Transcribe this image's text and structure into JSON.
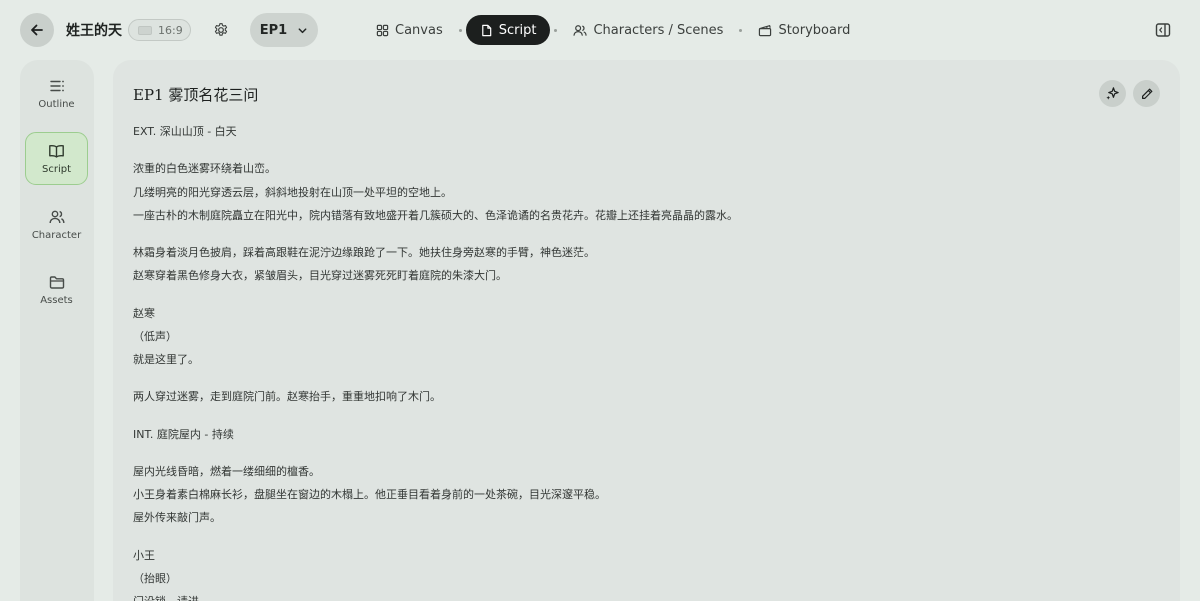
{
  "header": {
    "project_title": "姓王的天",
    "aspect_ratio": "16:9",
    "episode": "EP1",
    "tabs": [
      {
        "label": "Canvas",
        "icon": "grid-icon"
      },
      {
        "label": "Script",
        "icon": "document-icon",
        "active": true
      },
      {
        "label": "Characters / Scenes",
        "icon": "people-icon"
      },
      {
        "label": "Storyboard",
        "icon": "clapperboard-icon"
      }
    ]
  },
  "sidebar": {
    "items": [
      {
        "label": "Outline",
        "icon": "list-icon"
      },
      {
        "label": "Script",
        "icon": "book-icon",
        "active": true
      },
      {
        "label": "Character",
        "icon": "users-icon"
      },
      {
        "label": "Assets",
        "icon": "folder-icon"
      }
    ]
  },
  "document": {
    "title": "EP1 雾顶名花三问",
    "lines": [
      "EXT. 深山山顶 - 白天",
      "",
      "浓重的白色迷雾环绕着山峦。",
      "几缕明亮的阳光穿透云层，斜斜地投射在山顶一处平坦的空地上。",
      "一座古朴的木制庭院矗立在阳光中，院内错落有致地盛开着几簇硕大的、色泽诡谲的名贵花卉。花瓣上还挂着亮晶晶的露水。",
      "",
      "林霜身着淡月色披肩，踩着高跟鞋在泥泞边缘踉跄了一下。她扶住身旁赵寒的手臂，神色迷茫。",
      "赵寒穿着黑色修身大衣，紧皱眉头，目光穿过迷雾死死盯着庭院的朱漆大门。",
      "",
      "赵寒",
      "（低声）",
      "就是这里了。",
      "",
      "两人穿过迷雾，走到庭院门前。赵寒抬手，重重地扣响了木门。",
      "",
      "INT. 庭院屋内 - 持续",
      "",
      "屋内光线昏暗，燃着一缕细细的檀香。",
      "小王身着素白棉麻长衫，盘腿坐在窗边的木榻上。他正垂目看着身前的一处茶碗，目光深邃平稳。",
      "屋外传来敲门声。",
      "",
      "小王",
      "（抬眼）",
      "门没锁，请进。"
    ]
  },
  "colors": {
    "background": "#e5ebe7",
    "active_tab": "#1c1f1e",
    "sidebar_active": "#d2e8cc",
    "sidebar_active_border": "#9ccd8f"
  }
}
